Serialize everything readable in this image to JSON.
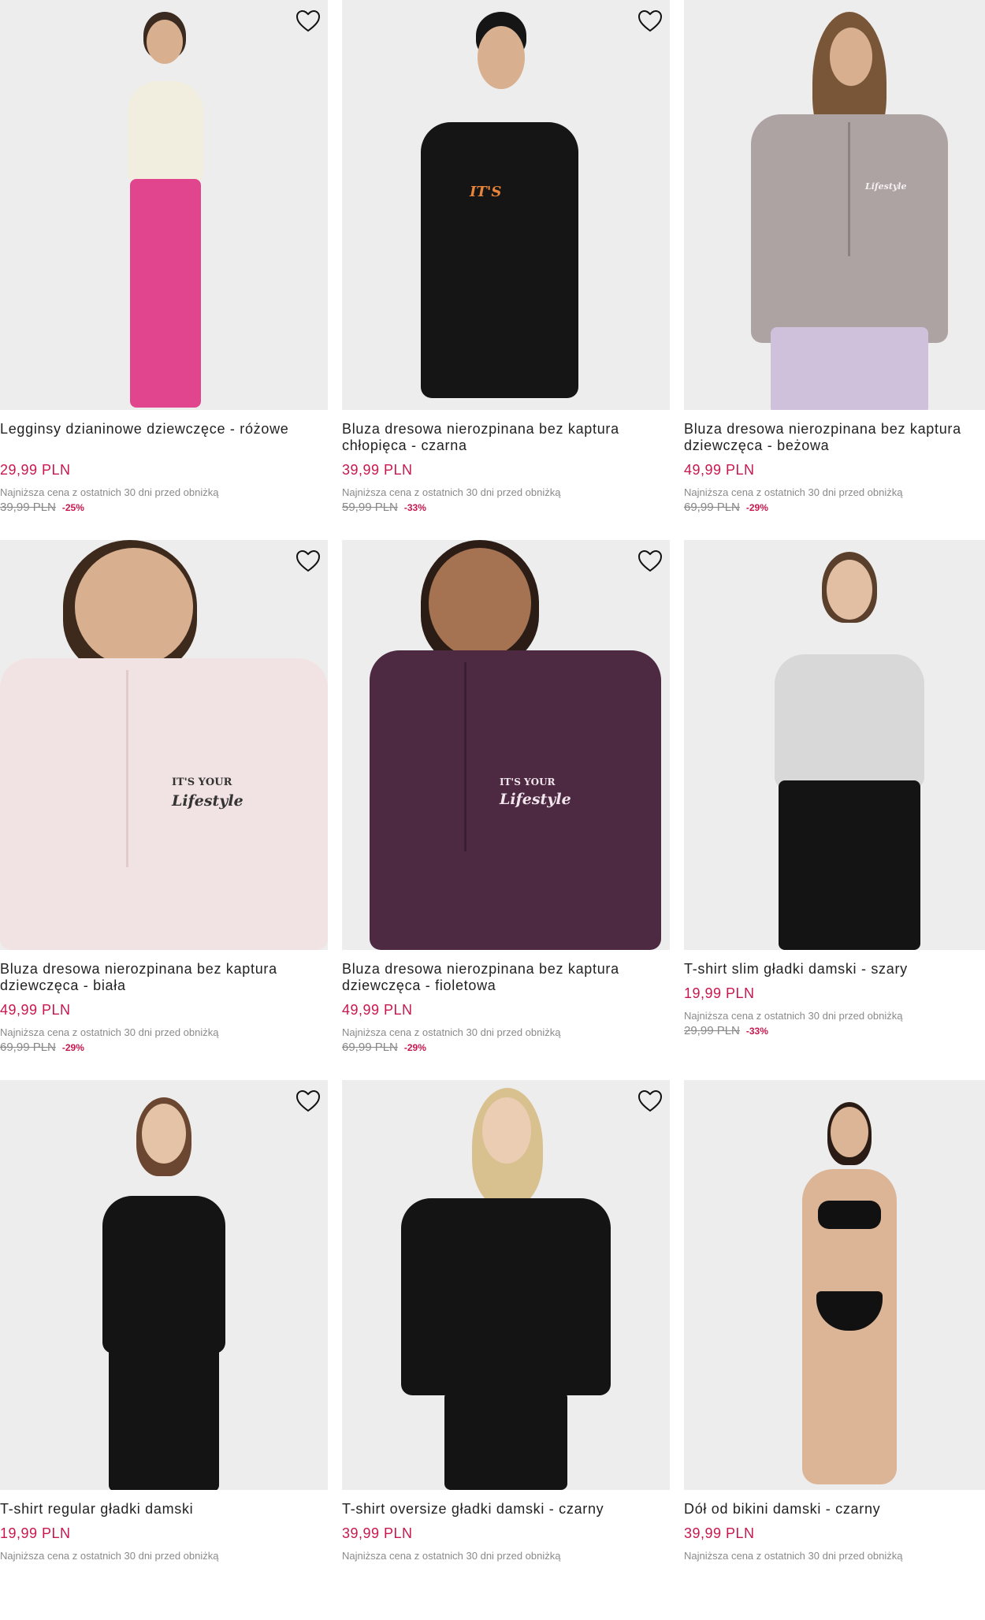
{
  "products": [
    {
      "name": "Leggins­y dzianinowe dziewczęce - różowe",
      "price": "29,99 PLN",
      "lowest_note": "Najniższa cena z ostatnich 30 dni przed obniżką",
      "old_price": "39,99 PLN",
      "discount": "-25%",
      "icon": "heart-outline-icon"
    },
    {
      "name": "Bluza dresowa nierozpinana bez kaptura chłopięca - czarna",
      "price": "39,99 PLN",
      "lowest_note": "Najniższa cena z ostatnich 30 dni przed obniżką",
      "old_price": "59,99 PLN",
      "discount": "-33%",
      "icon": "heart-outline-icon"
    },
    {
      "name": "Bluza dresowa nierozpinana bez kaptura dziewczęca - beżowa",
      "price": "49,99 PLN",
      "lowest_note": "Najniższa cena z ostatnich 30 dni przed obniżką",
      "old_price": "69,99 PLN",
      "discount": "-29%",
      "icon": "heart-outline-icon"
    },
    {
      "name": "Bluza dresowa nierozpinana bez kaptura dziewczęca - biała",
      "price": "49,99 PLN",
      "lowest_note": "Najniższa cena z ostatnich 30 dni przed obniżką",
      "old_price": "69,99 PLN",
      "discount": "-29%",
      "icon": "heart-outline-icon"
    },
    {
      "name": "Bluza dresowa nierozpinana bez kaptura dziewczęca - fioletowa",
      "price": "49,99 PLN",
      "lowest_note": "Najniższa cena z ostatnich 30 dni przed obniżką",
      "old_price": "69,99 PLN",
      "discount": "-29%",
      "icon": "heart-outline-icon"
    },
    {
      "name": "T-shirt slim gładki damski - szary",
      "price": "19,99 PLN",
      "lowest_note": "Najniższa cena z ostatnich 30 dni przed obniżką",
      "old_price": "29,99 PLN",
      "discount": "-33%",
      "icon": "heart-outline-icon"
    },
    {
      "name": "T-shirt regular gładki damski",
      "price": "19,99 PLN",
      "lowest_note": "Najniższa cena z ostatnich 30 dni przed obniżką",
      "old_price": "",
      "discount": "",
      "icon": "heart-outline-icon"
    },
    {
      "name": "T-shirt oversize gładki damski - czarny",
      "price": "39,99 PLN",
      "lowest_note": "Najniższa cena z ostatnich 30 dni przed obniżką",
      "old_price": "",
      "discount": "",
      "icon": "heart-outline-icon"
    },
    {
      "name": "Dół od bikini damski - czarny",
      "price": "39,99 PLN",
      "lowest_note": "Najniższa cena z ostatnich 30 dni przed obniżką",
      "old_price": "",
      "discount": "",
      "icon": "heart-outline-icon"
    }
  ],
  "prints": {
    "its_your": "IT'S YOUR",
    "lifestyle": "Lifestyle"
  },
  "colors": {
    "price": "#c8174f",
    "image_bg": "#ededed"
  }
}
